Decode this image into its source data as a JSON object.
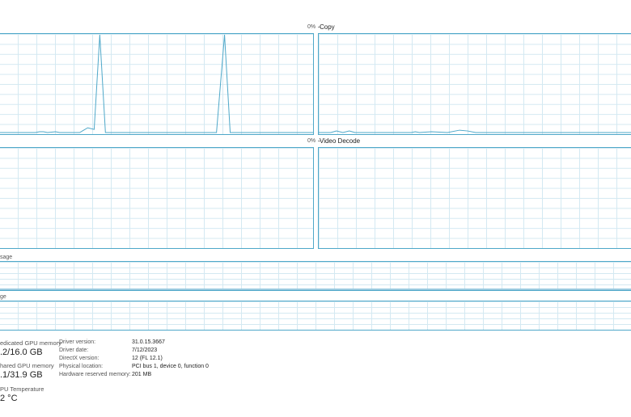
{
  "engines": {
    "top_left_pct": "0%",
    "top_right_title": "Copy",
    "mid_left_pct": "0%",
    "mid_right_title": "Video Decode"
  },
  "memory_graphs": {
    "dedicated_title": "sage",
    "shared_title": "ge"
  },
  "stats": {
    "dedicated_label": "edicated GPU memory",
    "dedicated_value": ".2/16.0 GB",
    "shared_label": "hared GPU memory",
    "shared_value": ".1/31.9 GB",
    "temp_label": "PU Temperature",
    "temp_value": "2 °C"
  },
  "driver_info": {
    "rows": [
      {
        "key": "Driver version:",
        "value": "31.0.15.3667"
      },
      {
        "key": "Driver date:",
        "value": "7/12/2023"
      },
      {
        "key": "DirectX version:",
        "value": "12 (FL 12.1)"
      },
      {
        "key": "Physical location:",
        "value": "PCI bus 1, device 0, function 0"
      },
      {
        "key": "Hardware reserved memory:",
        "value": "201 MB"
      }
    ]
  },
  "colors": {
    "graph_border": "#4fa8c9",
    "grid": "#d4e9f2",
    "line": "#4fa8c9"
  }
}
